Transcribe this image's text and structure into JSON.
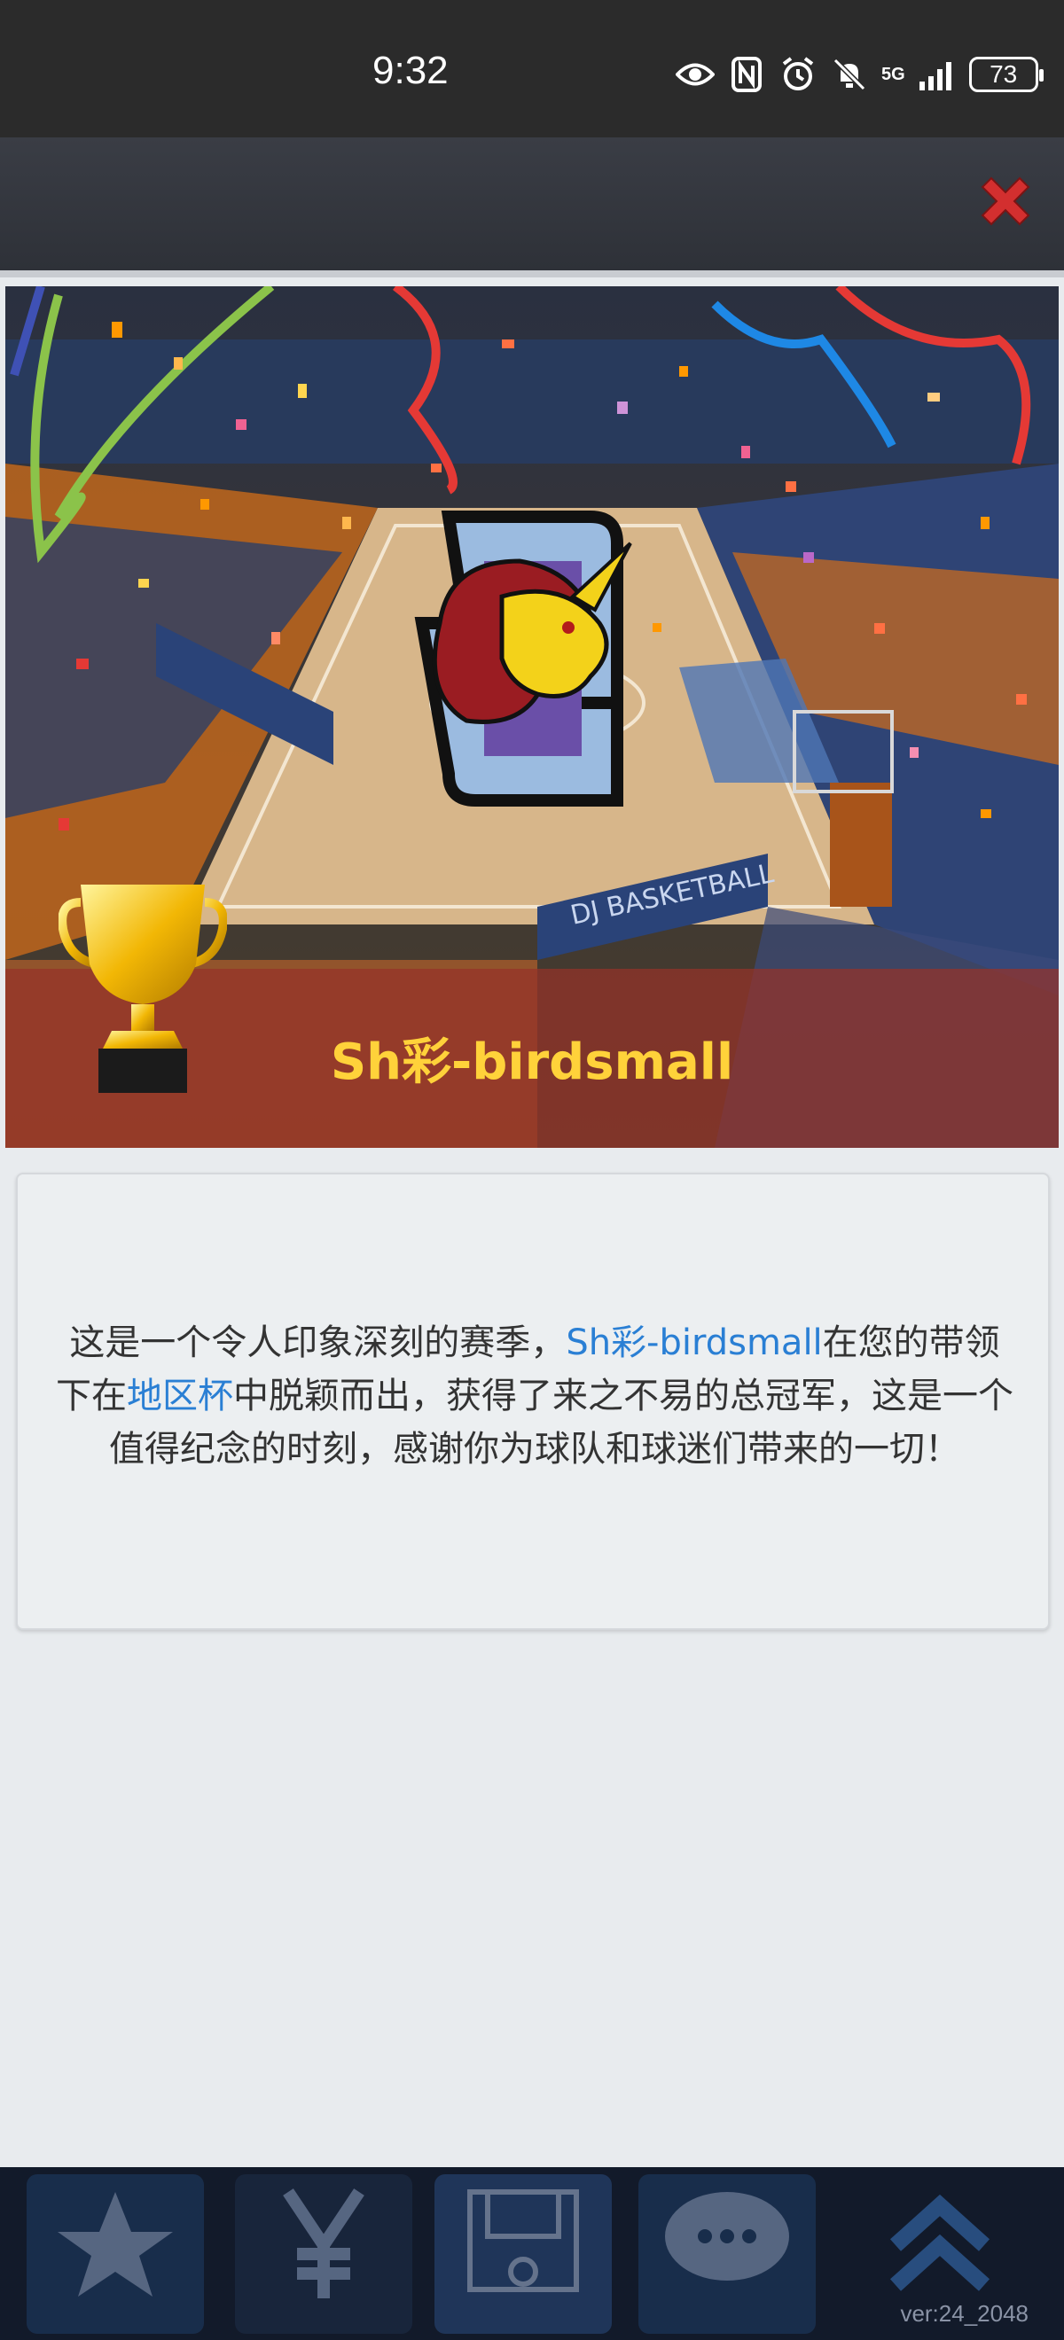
{
  "status_bar": {
    "time": "9:32",
    "network": "5G",
    "battery": "73"
  },
  "banner": {
    "team_name": "Sh彩-birdsmall",
    "court_sign": "DJ BASKETBALL"
  },
  "message": {
    "part1": "这是一个令人印象深刻的赛季，",
    "team": "Sh彩-birdsmall",
    "part2": "在您的带领下在",
    "cup": "地区杯",
    "part3": "中脱颖而出，获得了来之不易的总冠军，这是一个值得纪念的时刻，感谢你为球队和球迷们带来的一切！"
  },
  "bottom_nav": {
    "items": [
      {
        "icon": "star-icon"
      },
      {
        "icon": "yen-icon"
      },
      {
        "icon": "court-icon"
      },
      {
        "icon": "chat-icon"
      },
      {
        "icon": "chevron-up-icon"
      }
    ],
    "version": "ver:24_2048"
  },
  "colors": {
    "accent_link": "#2a7fd4",
    "team_name": "#ffd23a",
    "close_red": "#d32f2f"
  }
}
